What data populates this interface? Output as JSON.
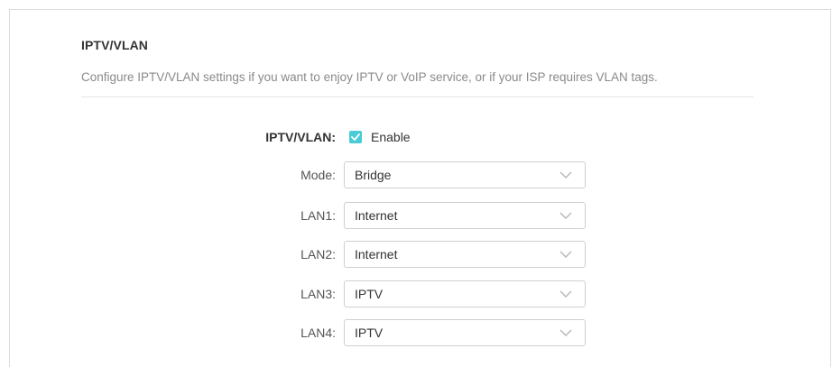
{
  "section": {
    "title": "IPTV/VLAN",
    "description": "Configure IPTV/VLAN settings if you want to enjoy IPTV or VoIP service, or if your ISP requires VLAN tags."
  },
  "iptv_vlan": {
    "label": "IPTV/VLAN:",
    "checkbox_label": "Enable",
    "checked": true
  },
  "mode": {
    "label": "Mode:",
    "value": "Bridge"
  },
  "lan1": {
    "label": "LAN1:",
    "value": "Internet"
  },
  "lan2": {
    "label": "LAN2:",
    "value": "Internet"
  },
  "lan3": {
    "label": "LAN3:",
    "value": "IPTV"
  },
  "lan4": {
    "label": "LAN4:",
    "value": "IPTV"
  },
  "colors": {
    "accent": "#4acbd6",
    "border": "#cfcfcf",
    "muted_text": "#8a8a8a"
  },
  "icons": {
    "checkbox": "check-icon",
    "dropdown": "chevron-down-icon"
  }
}
